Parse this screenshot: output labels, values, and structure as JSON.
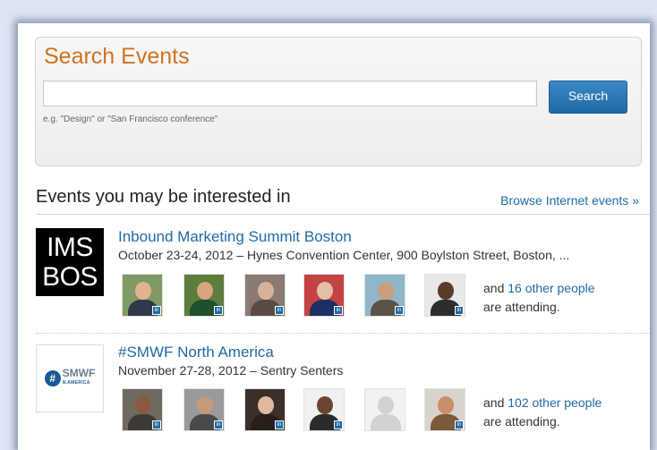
{
  "search": {
    "title": "Search Events",
    "placeholder": "",
    "button_label": "Search",
    "hint": "e.g. \"Design\" or \"San Francisco conference\""
  },
  "section": {
    "heading": "Events you may be interested in",
    "browse_link": "Browse Internet events »"
  },
  "events": [
    {
      "logo_line1": "IMS",
      "logo_line2": "BOS",
      "title": "Inbound Marketing Summit Boston",
      "details": "October 23-24, 2012 – Hynes Convention Center, 900 Boylston Street, Boston, ...",
      "attend_prefix": "and",
      "attend_link": "16 other people",
      "attend_suffix": "are attending.",
      "attendees": [
        "attendee-1",
        "attendee-2",
        "attendee-3",
        "attendee-4",
        "attendee-5",
        "attendee-6"
      ]
    },
    {
      "logo_hash": "#",
      "logo_text": "SMWF",
      "logo_sub": "N.AMERICA",
      "title": "#SMWF North America",
      "details": "November 27-28, 2012 – Sentry Senters",
      "attend_prefix": "and",
      "attend_link": "102 other people",
      "attend_suffix": "are attending.",
      "attendees": [
        "attendee-1",
        "attendee-2",
        "attendee-3",
        "attendee-4",
        "attendee-5",
        "attendee-6"
      ]
    }
  ],
  "colors": {
    "accent_orange": "#d0731f",
    "link_blue": "#1f6aa6",
    "button_blue": "#2a7ab8"
  }
}
